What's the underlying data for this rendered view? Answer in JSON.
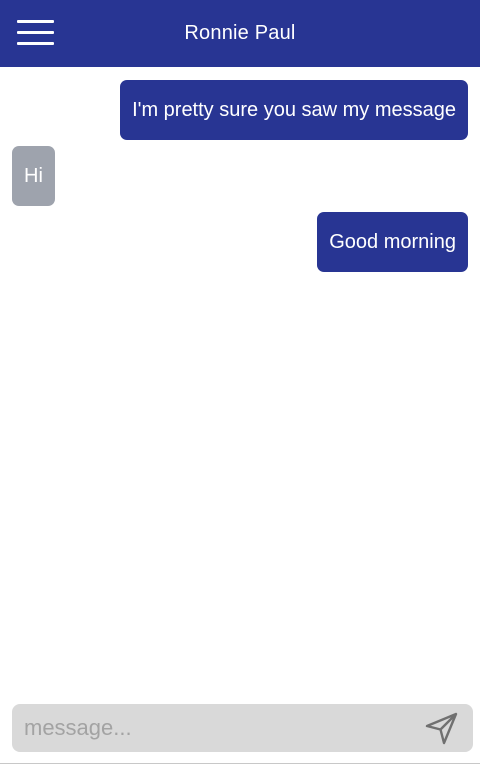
{
  "header": {
    "title": "Ronnie Paul",
    "menu_icon": "hamburger-menu-icon",
    "background_color": "#283593"
  },
  "messages": [
    {
      "direction": "sent",
      "text": "I'm pretty sure you saw my message"
    },
    {
      "direction": "received",
      "text": "Hi"
    },
    {
      "direction": "sent",
      "text": "Good morning"
    }
  ],
  "composer": {
    "value": "",
    "placeholder": "message...",
    "send_icon": "send-icon"
  },
  "colors": {
    "sent_bubble": "#283593",
    "received_bubble": "#9ea3ad",
    "composer_background": "#d9d9d9"
  }
}
